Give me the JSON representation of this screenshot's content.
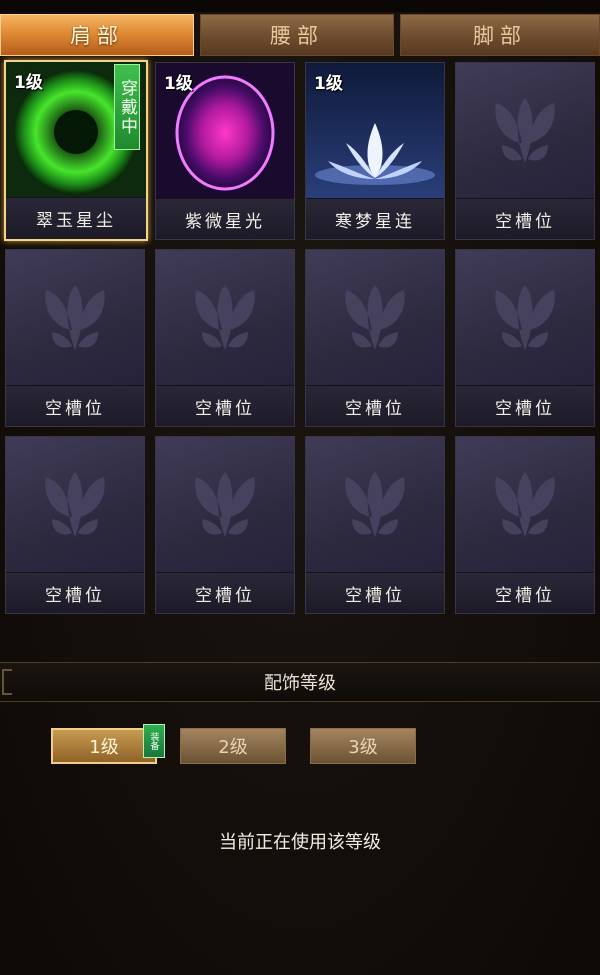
{
  "tabs": [
    {
      "label": "肩部",
      "active": true
    },
    {
      "label": "腰部",
      "active": false
    },
    {
      "label": "脚部",
      "active": false
    }
  ],
  "slots": [
    {
      "name": "翠玉星尘",
      "level": "1级",
      "wearing": "穿戴中",
      "art": "green-orb"
    },
    {
      "name": "紫微星光",
      "level": "1级",
      "art": "purple-orb"
    },
    {
      "name": "寒梦星连",
      "level": "1级",
      "art": "lotus"
    },
    {
      "name": "空槽位",
      "art": "empty"
    },
    {
      "name": "空槽位",
      "art": "empty"
    },
    {
      "name": "空槽位",
      "art": "empty"
    },
    {
      "name": "空槽位",
      "art": "empty"
    },
    {
      "name": "空槽位",
      "art": "empty"
    },
    {
      "name": "空槽位",
      "art": "empty"
    },
    {
      "name": "空槽位",
      "art": "empty"
    },
    {
      "name": "空槽位",
      "art": "empty"
    },
    {
      "name": "空槽位",
      "art": "empty"
    }
  ],
  "section": {
    "title": "配饰等级"
  },
  "levels": [
    {
      "label": "1级",
      "active": true,
      "badge": "装备"
    },
    {
      "label": "2级",
      "active": false
    },
    {
      "label": "3级",
      "active": false
    }
  ],
  "status_text": "当前正在使用该等级",
  "colors": {
    "accent": "#f6d389",
    "wear_green": "#2fae52",
    "tab_active": "#e08a35"
  }
}
